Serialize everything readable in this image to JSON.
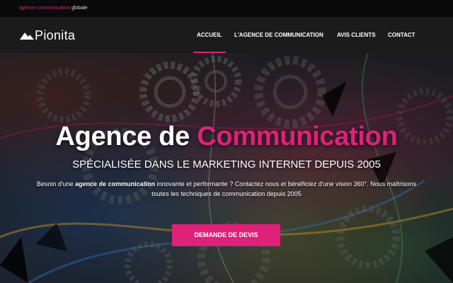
{
  "topbar": {
    "tagline_pink": "agence communication",
    "tagline_white": "globale"
  },
  "logo": {
    "text_start": "P",
    "text_i": "i",
    "text_mid": "on",
    "text_i2": "i",
    "text_end": "ta"
  },
  "nav": {
    "items": [
      {
        "label": "ACCUEIL",
        "active": true
      },
      {
        "label": "L'AGENCE DE COMMUNICATION",
        "active": false
      },
      {
        "label": "AVIS CLIENTS",
        "active": false
      },
      {
        "label": "CONTACT",
        "active": false
      }
    ]
  },
  "hero": {
    "title_white": "Agence de",
    "title_pink": "Communication",
    "subtitle": "SPÉCIALISÉE DANS LE MARKETING INTERNET DEPUIS 2005",
    "desc_part1": "Besoin d'une ",
    "desc_bold": "agence de communication",
    "desc_part2": " innovante et performante ? Contactez nous et bénéficiez d'une vision 360°. Nous maîtrisons toutes les techniques de communication depuis 2005",
    "cta_label": "DEMANDE DE DEVIS"
  },
  "colors": {
    "accent": "#e0217a",
    "topbar_bg": "#0a0a0a",
    "navbar_bg": "#1b1b1b"
  },
  "icons": {
    "logo_mark": "mountain-icon"
  }
}
